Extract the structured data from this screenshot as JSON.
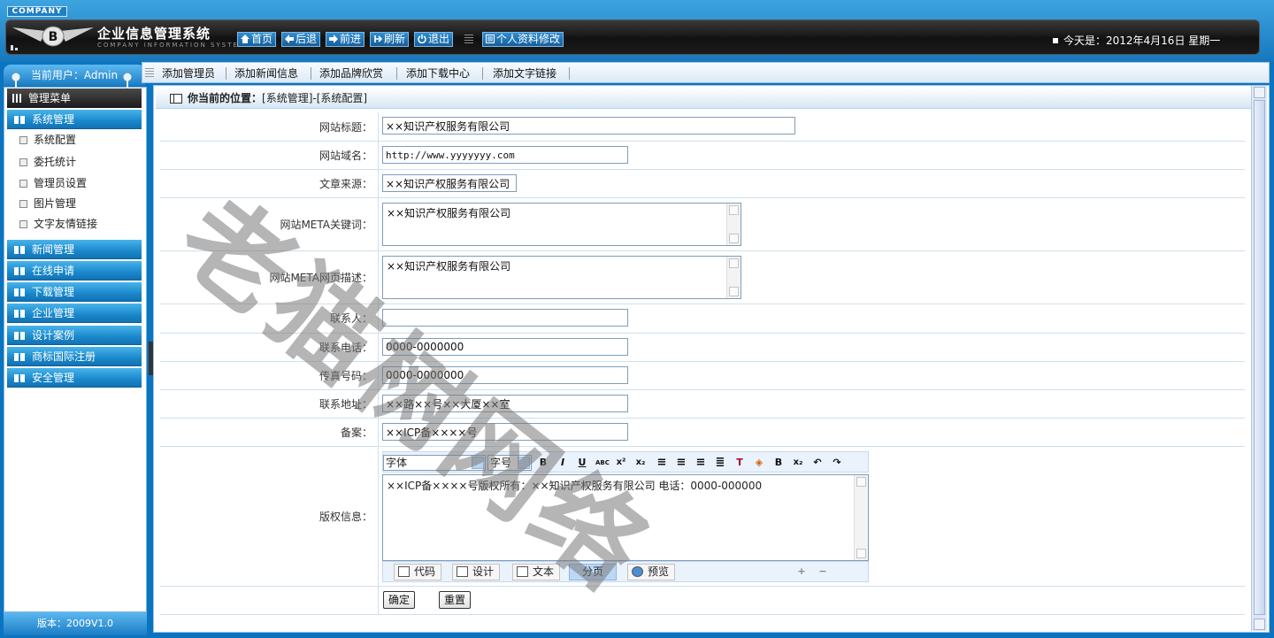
{
  "header": {
    "company_tag": "COMPANY",
    "title": "企业信息管理系统",
    "subtitle": "COMPANY INFORMATION SYSTEM",
    "nav": [
      {
        "label": "首页",
        "icon": "home-icon"
      },
      {
        "label": "后退",
        "icon": "arrow-left-icon"
      },
      {
        "label": "前进",
        "icon": "arrow-right-icon"
      },
      {
        "label": "刷新",
        "icon": "refresh-icon"
      },
      {
        "label": "退出",
        "icon": "power-icon"
      },
      {
        "label": "个人资料修改",
        "icon": "profile-icon"
      }
    ],
    "date": "今天是：2012年4月16日 星期一"
  },
  "sidebar": {
    "current_user": "当前用户：Admin",
    "menu_title": "管理菜单",
    "categories": [
      {
        "label": "系统管理",
        "items": [
          "系统配置",
          "委托统计",
          "管理员设置",
          "图片管理",
          "文字友情链接"
        ]
      },
      {
        "label": "新闻管理"
      },
      {
        "label": "在线申请"
      },
      {
        "label": "下载管理"
      },
      {
        "label": "企业管理"
      },
      {
        "label": "设计案例"
      },
      {
        "label": "商标国际注册"
      },
      {
        "label": "安全管理"
      }
    ],
    "version": "版本：2009V1.0"
  },
  "quickbar": {
    "links": [
      "添加管理员",
      "添加新闻信息",
      "添加品牌欣赏",
      "添加下载中心",
      "添加文字链接"
    ]
  },
  "breadcrumb": {
    "label": "你当前的位置：",
    "path": "[系统管理]-[系统配置]"
  },
  "form": {
    "site_title": {
      "label": "网站标题：",
      "value": "××知识产权服务有限公司"
    },
    "site_domain": {
      "label": "网站域名：",
      "value": "http://www.yyyyyyy.com"
    },
    "article_source": {
      "label": "文章来源：",
      "value": "××知识产权服务有限公司"
    },
    "meta_keywords": {
      "label": "网站META关键词：",
      "value": "××知识产权服务有限公司"
    },
    "meta_description": {
      "label": "网站META网页描述：",
      "value": "××知识产权服务有限公司"
    },
    "contact": {
      "label": "联系人：",
      "value": ""
    },
    "phone": {
      "label": "联系电话：",
      "value": "0000-0000000"
    },
    "fax": {
      "label": "传真号码：",
      "value": "0000-0000000"
    },
    "address": {
      "label": "联系地址：",
      "value": "××路××号××大厦××室"
    },
    "icp": {
      "label": "备案：",
      "value": "××ICP备××××号"
    },
    "copyright": {
      "label": "版权信息：",
      "value": "××ICP备××××号版权所有：××知识产权服务有限公司 电话：0000-000000"
    }
  },
  "editor": {
    "font_select": "字体",
    "size_select": "字号",
    "tabs": [
      "代码",
      "设计",
      "文本",
      "分页",
      "预览"
    ]
  },
  "buttons": {
    "confirm": "确定",
    "reset": "重置"
  },
  "watermark": "老猫树网络",
  "colors": {
    "primary_blue": "#0b74c0",
    "header_bar": "#111111",
    "menu_category": "#1a88cc"
  }
}
